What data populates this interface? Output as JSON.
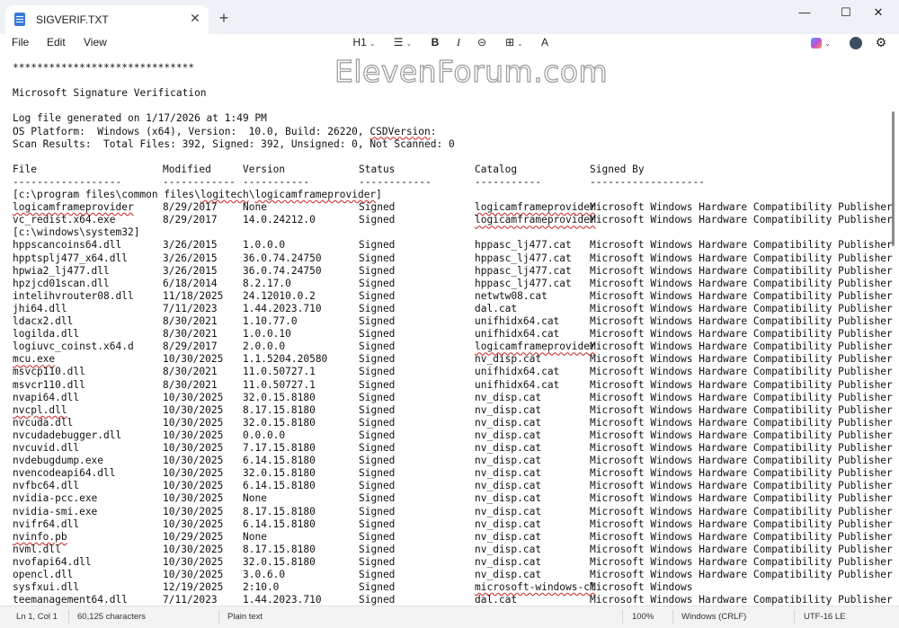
{
  "window": {
    "tab_title": "SIGVERIF.TXT",
    "close_tab_glyph": "✕",
    "new_tab_glyph": "+",
    "min_glyph": "—",
    "max_glyph": "☐",
    "close_glyph": "✕"
  },
  "menu": {
    "file": "File",
    "edit": "Edit",
    "view": "View"
  },
  "toolbar": {
    "heading": "H1",
    "list_glyph": "☰",
    "bold": "B",
    "italic": "I",
    "link_glyph": "⊝",
    "table_glyph": "⊞",
    "spell_glyph": "A",
    "chevron": "⌄",
    "settings_glyph": "⚙"
  },
  "watermark": "ElevenForum.com",
  "document": {
    "header_lines": [
      "******************************",
      "",
      "Microsoft Signature Verification",
      "",
      "Log file generated on 1/17/2026 at 1:49 PM",
      "OS Platform:  Windows (x64), Version:  10.0, Build: 26220, CSDVersion:",
      "Scan Results:  Total Files: 392, Signed: 392, Unsigned: 0, Not Scanned: 0",
      ""
    ],
    "column_headers": [
      "File",
      "Modified",
      "Version",
      "Status",
      "Catalog",
      "Signed By"
    ],
    "column_rules": [
      "------------------",
      "------------",
      "-----------",
      "------------",
      "-----------",
      "-------------------"
    ],
    "dir1": "[c:\\program files\\common files\\logitech\\logicamframeprovider]",
    "rows1": [
      [
        "logicamframeprovider",
        "8/29/2017",
        "None",
        "Signed",
        "logicamframeprovider",
        "Microsoft Windows Hardware Compatibility Publisher"
      ],
      [
        "vc_redist.x64.exe",
        "8/29/2017",
        "14.0.24212.0",
        "Signed",
        "logicamframeprovider",
        "Microsoft Windows Hardware Compatibility Publisher"
      ]
    ],
    "dir2": "[c:\\windows\\system32]",
    "rows2": [
      [
        "hppscancoins64.dll",
        "3/26/2015",
        "1.0.0.0",
        "Signed",
        "hppasc_lj477.cat",
        "Microsoft Windows Hardware Compatibility Publisher"
      ],
      [
        "hpptsplj477_x64.dll",
        "3/26/2015",
        "36.0.74.24750",
        "Signed",
        "hppasc_lj477.cat",
        "Microsoft Windows Hardware Compatibility Publisher"
      ],
      [
        "hpwia2_lj477.dll",
        "3/26/2015",
        "36.0.74.24750",
        "Signed",
        "hppasc_lj477.cat",
        "Microsoft Windows Hardware Compatibility Publisher"
      ],
      [
        "hpzjcd01scan.dll",
        "6/18/2014",
        "8.2.17.0",
        "Signed",
        "hppasc_lj477.cat",
        "Microsoft Windows Hardware Compatibility Publisher"
      ],
      [
        "intelihvrouter08.dll",
        "11/18/2025",
        "24.12010.0.2",
        "Signed",
        "netwtw08.cat",
        "Microsoft Windows Hardware Compatibility Publisher"
      ],
      [
        "jhi64.dll",
        "7/11/2023",
        "1.44.2023.710",
        "Signed",
        "dal.cat",
        "Microsoft Windows Hardware Compatibility Publisher"
      ],
      [
        "ldacx2.dll",
        "8/30/2021",
        "1.10.77.0",
        "Signed",
        "unifhidx64.cat",
        "Microsoft Windows Hardware Compatibility Publisher"
      ],
      [
        "logilda.dll",
        "8/30/2021",
        "1.0.0.10",
        "Signed",
        "unifhidx64.cat",
        "Microsoft Windows Hardware Compatibility Publisher"
      ],
      [
        "logiuvc_coinst.x64.d",
        "8/29/2017",
        "2.0.0.0",
        "Signed",
        "logicamframeprovider",
        "Microsoft Windows Hardware Compatibility Publisher"
      ],
      [
        "mcu.exe",
        "10/30/2025",
        "1.1.5204.20580",
        "Signed",
        "nv_disp.cat",
        "Microsoft Windows Hardware Compatibility Publisher"
      ],
      [
        "msvcp110.dll",
        "8/30/2021",
        "11.0.50727.1",
        "Signed",
        "unifhidx64.cat",
        "Microsoft Windows Hardware Compatibility Publisher"
      ],
      [
        "msvcr110.dll",
        "8/30/2021",
        "11.0.50727.1",
        "Signed",
        "unifhidx64.cat",
        "Microsoft Windows Hardware Compatibility Publisher"
      ],
      [
        "nvapi64.dll",
        "10/30/2025",
        "32.0.15.8180",
        "Signed",
        "nv_disp.cat",
        "Microsoft Windows Hardware Compatibility Publisher"
      ],
      [
        "nvcpl.dll",
        "10/30/2025",
        "8.17.15.8180",
        "Signed",
        "nv_disp.cat",
        "Microsoft Windows Hardware Compatibility Publisher"
      ],
      [
        "nvcuda.dll",
        "10/30/2025",
        "32.0.15.8180",
        "Signed",
        "nv_disp.cat",
        "Microsoft Windows Hardware Compatibility Publisher"
      ],
      [
        "nvcudadebugger.dll",
        "10/30/2025",
        "0.0.0.0",
        "Signed",
        "nv_disp.cat",
        "Microsoft Windows Hardware Compatibility Publisher"
      ],
      [
        "nvcuvid.dll",
        "10/30/2025",
        "7.17.15.8180",
        "Signed",
        "nv_disp.cat",
        "Microsoft Windows Hardware Compatibility Publisher"
      ],
      [
        "nvdebugdump.exe",
        "10/30/2025",
        "6.14.15.8180",
        "Signed",
        "nv_disp.cat",
        "Microsoft Windows Hardware Compatibility Publisher"
      ],
      [
        "nvencodeapi64.dll",
        "10/30/2025",
        "32.0.15.8180",
        "Signed",
        "nv_disp.cat",
        "Microsoft Windows Hardware Compatibility Publisher"
      ],
      [
        "nvfbc64.dll",
        "10/30/2025",
        "6.14.15.8180",
        "Signed",
        "nv_disp.cat",
        "Microsoft Windows Hardware Compatibility Publisher"
      ],
      [
        "nvidia-pcc.exe",
        "10/30/2025",
        "None",
        "Signed",
        "nv_disp.cat",
        "Microsoft Windows Hardware Compatibility Publisher"
      ],
      [
        "nvidia-smi.exe",
        "10/30/2025",
        "8.17.15.8180",
        "Signed",
        "nv_disp.cat",
        "Microsoft Windows Hardware Compatibility Publisher"
      ],
      [
        "nvifr64.dll",
        "10/30/2025",
        "6.14.15.8180",
        "Signed",
        "nv_disp.cat",
        "Microsoft Windows Hardware Compatibility Publisher"
      ],
      [
        "nvinfo.pb",
        "10/29/2025",
        "None",
        "Signed",
        "nv_disp.cat",
        "Microsoft Windows Hardware Compatibility Publisher"
      ],
      [
        "nvml.dll",
        "10/30/2025",
        "8.17.15.8180",
        "Signed",
        "nv_disp.cat",
        "Microsoft Windows Hardware Compatibility Publisher"
      ],
      [
        "nvofapi64.dll",
        "10/30/2025",
        "32.0.15.8180",
        "Signed",
        "nv_disp.cat",
        "Microsoft Windows Hardware Compatibility Publisher"
      ],
      [
        "opencl.dll",
        "10/30/2025",
        "3.0.6.0",
        "Signed",
        "nv_disp.cat",
        "Microsoft Windows Hardware Compatibility Publisher"
      ],
      [
        "sysfxui.dll",
        "12/19/2025",
        "2:10.0",
        "Signed",
        "microsoft-windows-cl",
        "Microsoft Windows"
      ],
      [
        "teemanagement64.dll",
        "7/11/2023",
        "1.44.2023.710",
        "Signed",
        "dal.cat",
        "Microsoft Windows Hardware Compatibility Publisher"
      ]
    ]
  },
  "status": {
    "position": "Ln 1, Col 1",
    "chars": "60,125 characters",
    "format": "Plain text",
    "zoom": "100%",
    "eol": "Windows (CRLF)",
    "encoding": "UTF-16 LE"
  }
}
